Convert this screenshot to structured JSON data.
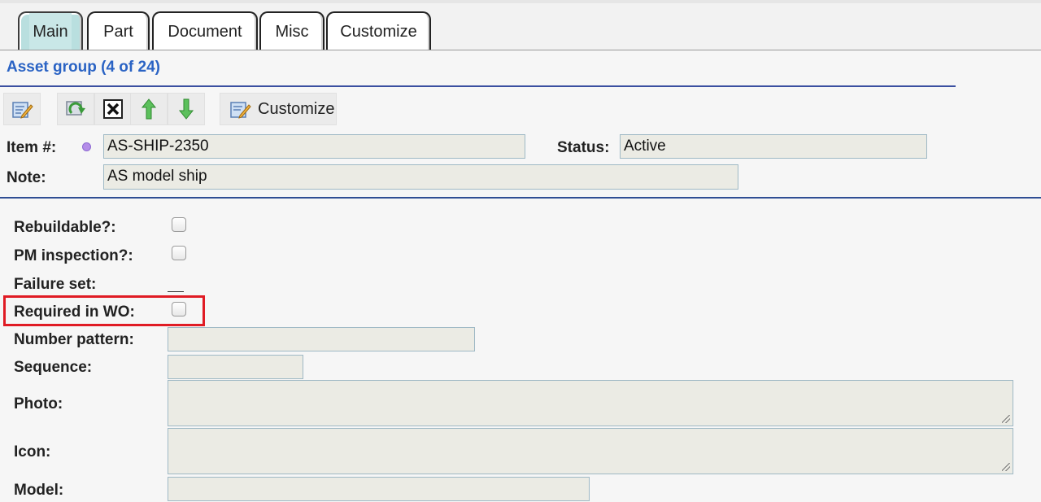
{
  "tabs": [
    {
      "label": "Main",
      "active": true
    },
    {
      "label": "Part",
      "active": false
    },
    {
      "label": "Document",
      "active": false
    },
    {
      "label": "Misc",
      "active": false
    },
    {
      "label": "Customize",
      "active": false
    }
  ],
  "header": {
    "title": "Asset group (4 of 24)"
  },
  "toolbar": {
    "icons": [
      "edit-icon",
      "refresh-icon",
      "delete-icon",
      "move-up-icon",
      "move-down-icon",
      "customize-icon"
    ],
    "customize_label": "Customize"
  },
  "record": {
    "item_label": "Item #:",
    "item_value": "AS-SHIP-2350",
    "status_label": "Status:",
    "status_value": "Active",
    "note_label": "Note:",
    "note_value": "AS model ship"
  },
  "form": {
    "rebuildable_label": "Rebuildable?:",
    "rebuildable_checked": false,
    "pm_inspection_label": "PM inspection?:",
    "pm_inspection_checked": false,
    "failure_set_label": "Failure set:",
    "required_in_wo_label": "Required in WO:",
    "required_in_wo_checked": false,
    "number_pattern_label": "Number pattern:",
    "number_pattern_value": "",
    "sequence_label": "Sequence:",
    "sequence_value": "",
    "photo_label": "Photo:",
    "photo_value": "",
    "icon_label": "Icon:",
    "icon_value": "",
    "model_label": "Model:",
    "model_value": ""
  },
  "colors": {
    "active_tab": "#b9dfdf",
    "title": "#2a63c4",
    "highlight": "#e01b24",
    "field_bg": "#ebebe4"
  }
}
